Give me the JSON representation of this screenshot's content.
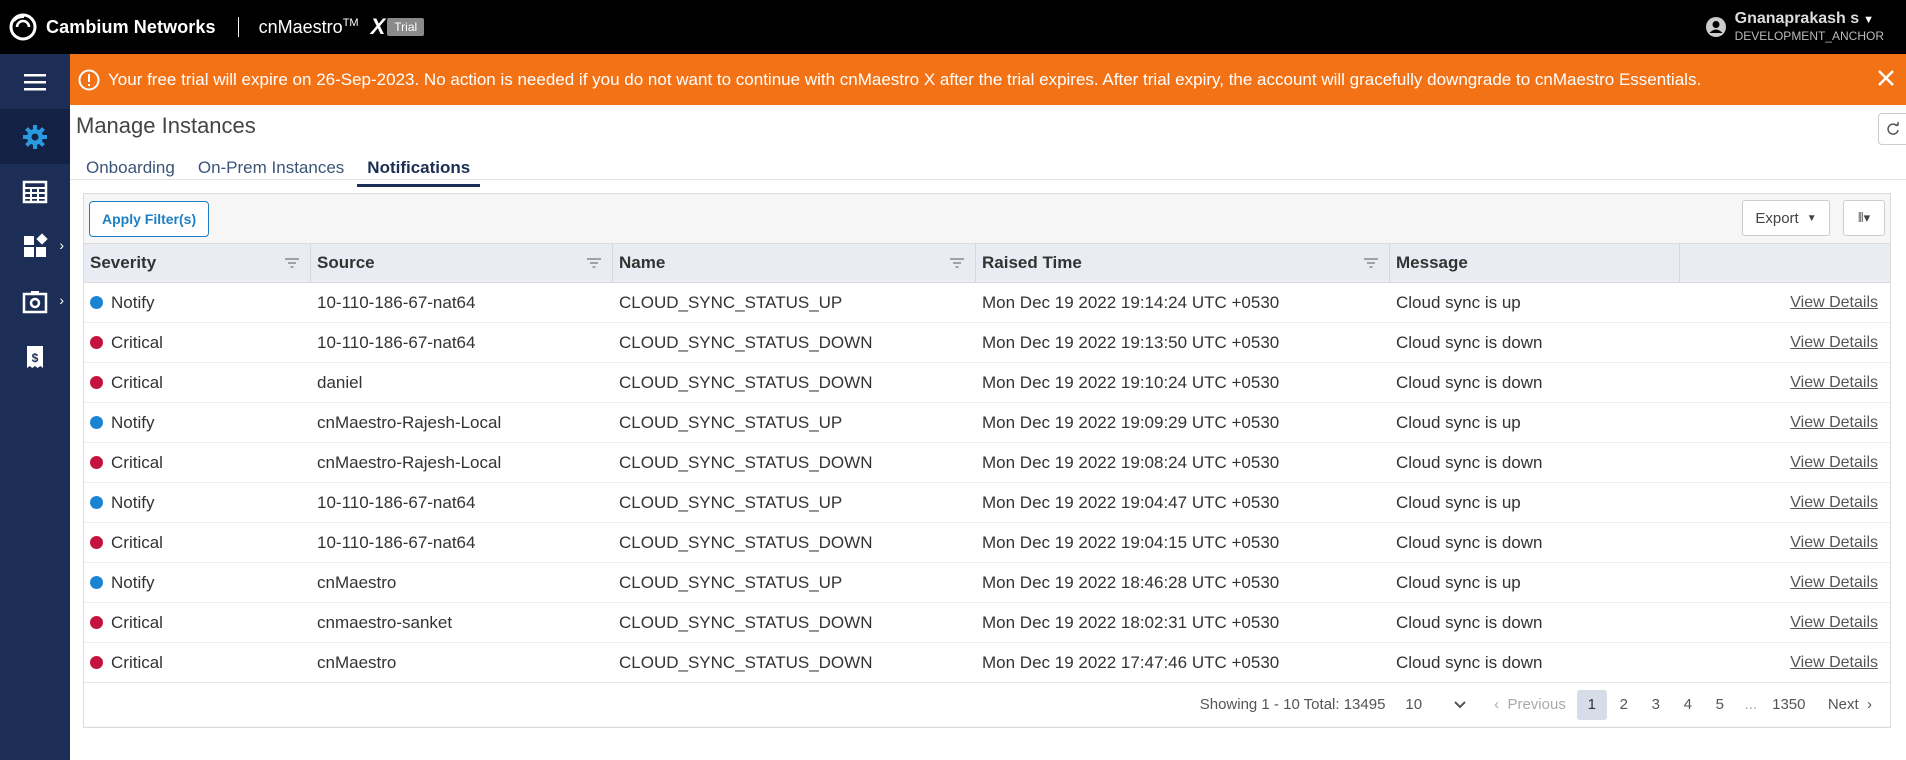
{
  "topbar": {
    "brand": "Cambium Networks",
    "product": "cnMaestro",
    "tm": "TM",
    "product_x": "X",
    "trial_badge": "Trial",
    "user_name": "Gnanaprakash s",
    "user_org": "DEVELOPMENT_ANCHOR"
  },
  "sidenav": {
    "items": [
      "menu-icon",
      "settings-icon",
      "table-icon",
      "apps-icon",
      "services-icon",
      "receipt-icon"
    ]
  },
  "banner": {
    "text": "Your free trial will expire on 26-Sep-2023. No action is needed if you do not want to continue with cnMaestro X after the trial expires. After trial expiry, the account will gracefully downgrade to cnMaestro Essentials.",
    "color": "#f47216"
  },
  "page": {
    "title": "Manage Instances",
    "tabs": [
      "Onboarding",
      "On-Prem Instances",
      "Notifications"
    ],
    "active_tab": "Notifications"
  },
  "toolbar": {
    "apply_filters": "Apply Filter(s)",
    "export": "Export"
  },
  "table": {
    "columns": [
      "Severity",
      "Source",
      "Name",
      "Raised Time",
      "Message"
    ],
    "link_label": "View Details",
    "severity_colors": {
      "Notify": "#1a84d4",
      "Critical": "#c2143e"
    },
    "rows": [
      {
        "severity": "Notify",
        "source": "10-110-186-67-nat64",
        "name": "CLOUD_SYNC_STATUS_UP",
        "time": "Mon Dec 19 2022 19:14:24 UTC +0530",
        "message": "Cloud sync is up"
      },
      {
        "severity": "Critical",
        "source": "10-110-186-67-nat64",
        "name": "CLOUD_SYNC_STATUS_DOWN",
        "time": "Mon Dec 19 2022 19:13:50 UTC +0530",
        "message": "Cloud sync is down"
      },
      {
        "severity": "Critical",
        "source": "daniel",
        "name": "CLOUD_SYNC_STATUS_DOWN",
        "time": "Mon Dec 19 2022 19:10:24 UTC +0530",
        "message": "Cloud sync is down"
      },
      {
        "severity": "Notify",
        "source": "cnMaestro-Rajesh-Local",
        "name": "CLOUD_SYNC_STATUS_UP",
        "time": "Mon Dec 19 2022 19:09:29 UTC +0530",
        "message": "Cloud sync is up"
      },
      {
        "severity": "Critical",
        "source": "cnMaestro-Rajesh-Local",
        "name": "CLOUD_SYNC_STATUS_DOWN",
        "time": "Mon Dec 19 2022 19:08:24 UTC +0530",
        "message": "Cloud sync is down"
      },
      {
        "severity": "Notify",
        "source": "10-110-186-67-nat64",
        "name": "CLOUD_SYNC_STATUS_UP",
        "time": "Mon Dec 19 2022 19:04:47 UTC +0530",
        "message": "Cloud sync is up"
      },
      {
        "severity": "Critical",
        "source": "10-110-186-67-nat64",
        "name": "CLOUD_SYNC_STATUS_DOWN",
        "time": "Mon Dec 19 2022 19:04:15 UTC +0530",
        "message": "Cloud sync is down"
      },
      {
        "severity": "Notify",
        "source": "cnMaestro",
        "name": "CLOUD_SYNC_STATUS_UP",
        "time": "Mon Dec 19 2022 18:46:28 UTC +0530",
        "message": "Cloud sync is up"
      },
      {
        "severity": "Critical",
        "source": "cnmaestro-sanket",
        "name": "CLOUD_SYNC_STATUS_DOWN",
        "time": "Mon Dec 19 2022 18:02:31 UTC +0530",
        "message": "Cloud sync is down"
      },
      {
        "severity": "Critical",
        "source": "cnMaestro",
        "name": "CLOUD_SYNC_STATUS_DOWN",
        "time": "Mon Dec 19 2022 17:47:46 UTC +0530",
        "message": "Cloud sync is down"
      }
    ]
  },
  "pager": {
    "summary": "Showing 1 - 10 Total: 13495",
    "page_size": "10",
    "previous": "Previous",
    "pages": [
      "1",
      "2",
      "3",
      "4",
      "5"
    ],
    "ellipsis": "...",
    "last_page": "1350",
    "next": "Next",
    "current": "1"
  }
}
